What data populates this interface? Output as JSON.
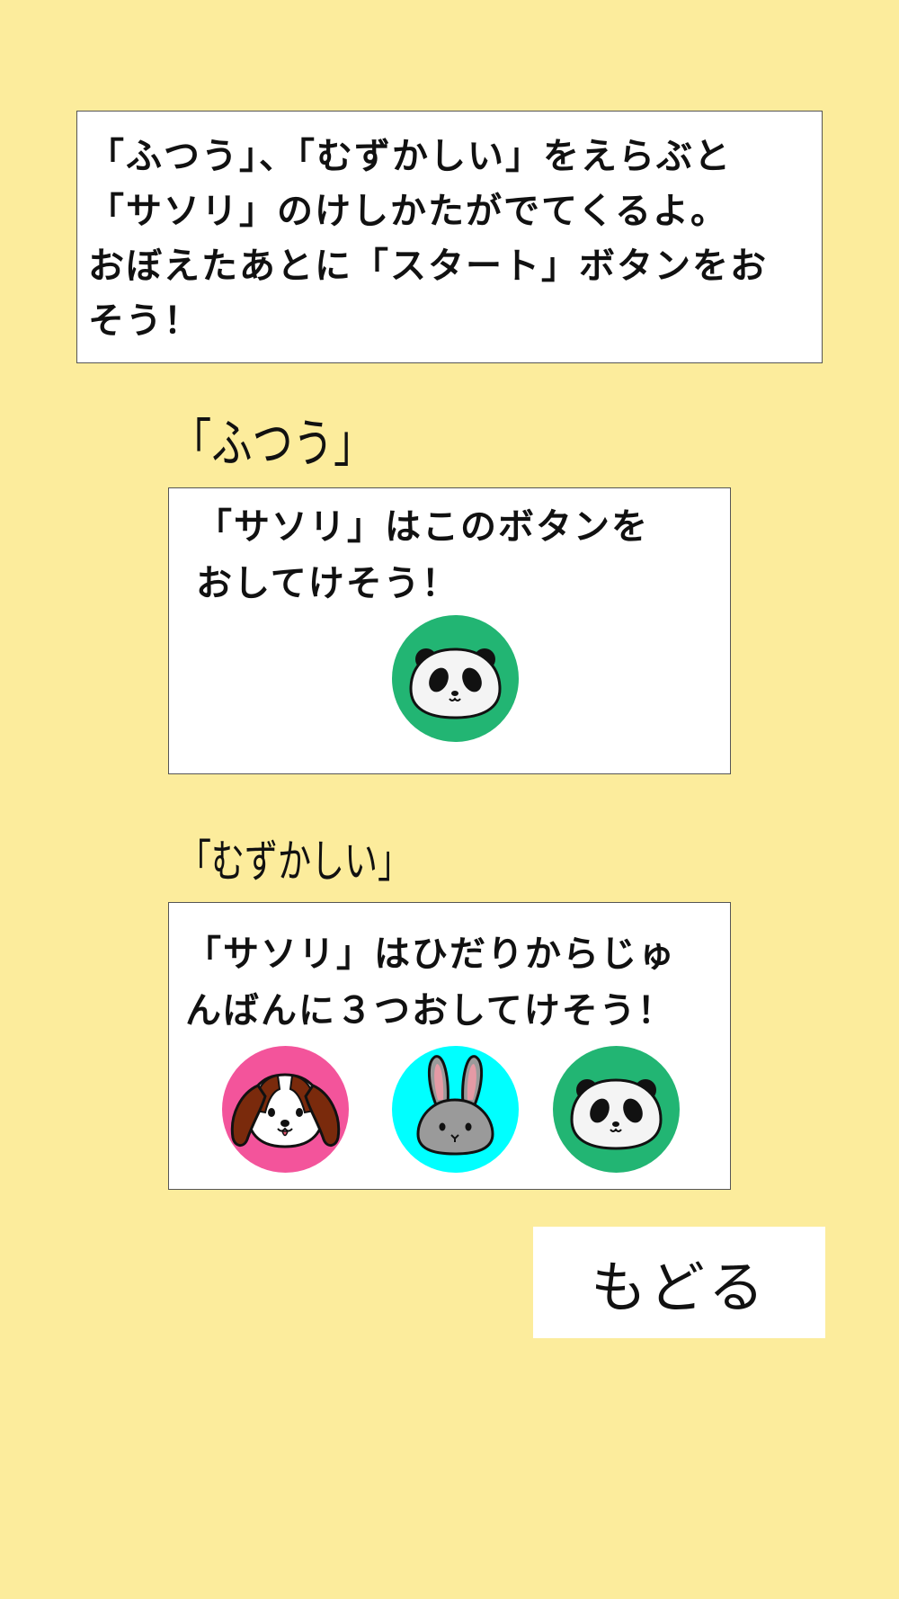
{
  "instructions": {
    "lines": [
      "「ふつう」、「むずかしい」をえらぶと",
      "「サソリ」のけしかたがでてくるよ。",
      "おぼえたあとに「スタート」ボタンをお",
      "そう！"
    ]
  },
  "normal": {
    "heading": "「ふつう」",
    "lines": [
      "「サソリ」はこのボタンを",
      "おしてけそう！"
    ],
    "buttons": [
      "panda-icon"
    ]
  },
  "hard": {
    "heading": "「むずかしい」",
    "lines": [
      "「サソリ」はひだりからじゅ",
      "んばんに３つおしてけそう！"
    ],
    "buttons": [
      "dog-icon",
      "rabbit-icon",
      "panda-icon"
    ]
  },
  "colors": {
    "background": "#fcec9c",
    "panda_button": "#22b573",
    "dog_button": "#f3549b",
    "rabbit_button": "#00ffff"
  },
  "back_button": {
    "label": "もどる"
  }
}
